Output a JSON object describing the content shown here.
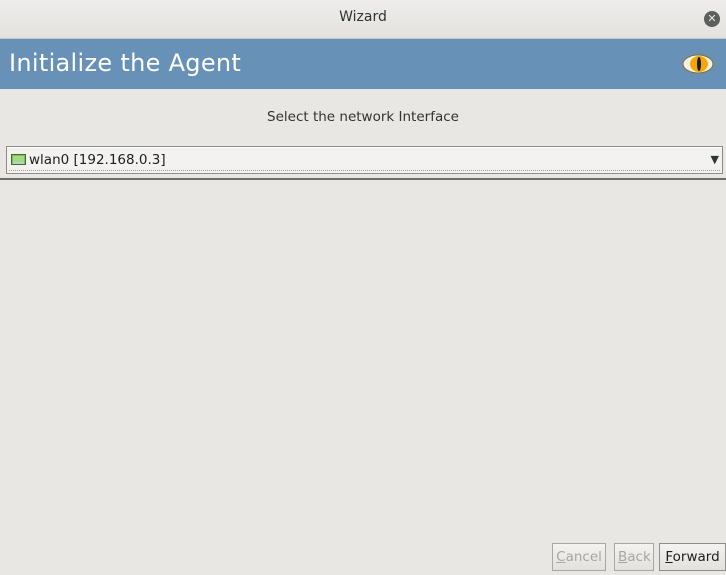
{
  "window": {
    "title": "Wizard"
  },
  "banner": {
    "title": "Initialize the Agent",
    "logo_icon": "cat-eye-icon"
  },
  "page": {
    "prompt": "Select the network Interface"
  },
  "interface_select": {
    "icon": "network-card-icon",
    "selected_value": "wlan0 [192.168.0.3]"
  },
  "buttons": {
    "cancel_label": "ancel",
    "cancel_mnemonic": "C",
    "back_label": "ack",
    "back_mnemonic": "B",
    "forward_label": "orward",
    "forward_mnemonic": "F"
  },
  "colors": {
    "banner": "#6891b8",
    "background": "#e8e7e4",
    "disabled_text": "#a6a6a3"
  }
}
